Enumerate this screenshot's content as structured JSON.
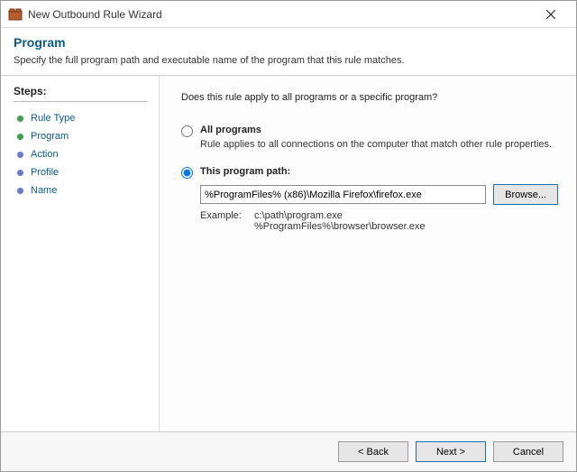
{
  "titlebar": {
    "title": "New Outbound Rule Wizard"
  },
  "header": {
    "title": "Program",
    "subtitle": "Specify the full program path and executable name of the program that this rule matches."
  },
  "sidebar": {
    "title": "Steps:",
    "steps": [
      {
        "label": "Rule Type"
      },
      {
        "label": "Program"
      },
      {
        "label": "Action"
      },
      {
        "label": "Profile"
      },
      {
        "label": "Name"
      }
    ]
  },
  "main": {
    "question": "Does this rule apply to all programs or a specific program?",
    "option_all": {
      "label": "All programs",
      "desc": "Rule applies to all connections on the computer that match other rule properties."
    },
    "option_path": {
      "label": "This program path:",
      "value": "%ProgramFiles% (x86)\\Mozilla Firefox\\firefox.exe",
      "browse": "Browse..."
    },
    "example": {
      "label": "Example:",
      "values": "c:\\path\\program.exe\n%ProgramFiles%\\browser\\browser.exe"
    }
  },
  "footer": {
    "back": "< Back",
    "next": "Next >",
    "cancel": "Cancel"
  }
}
